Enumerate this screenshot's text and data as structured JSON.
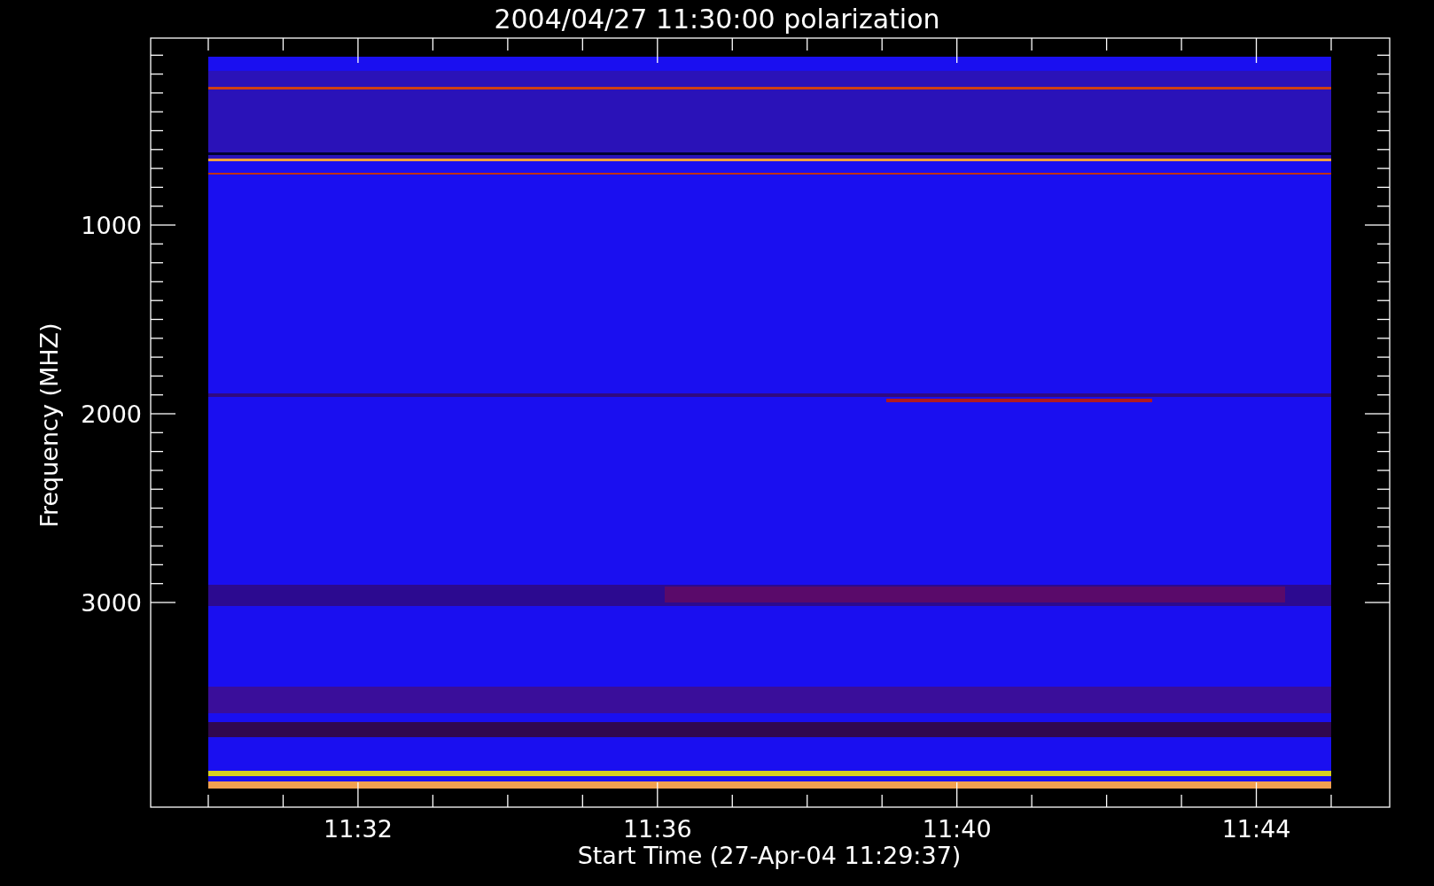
{
  "title": "2004/04/27 11:30:00 polarization",
  "y_axis": {
    "label": "Frequency (MHZ)",
    "ticks": [
      "1000",
      "2000",
      "3000"
    ]
  },
  "x_axis": {
    "label": "Start Time (27-Apr-04 11:29:37)",
    "ticks": [
      "11:32",
      "11:36",
      "11:40",
      "11:44"
    ]
  }
}
